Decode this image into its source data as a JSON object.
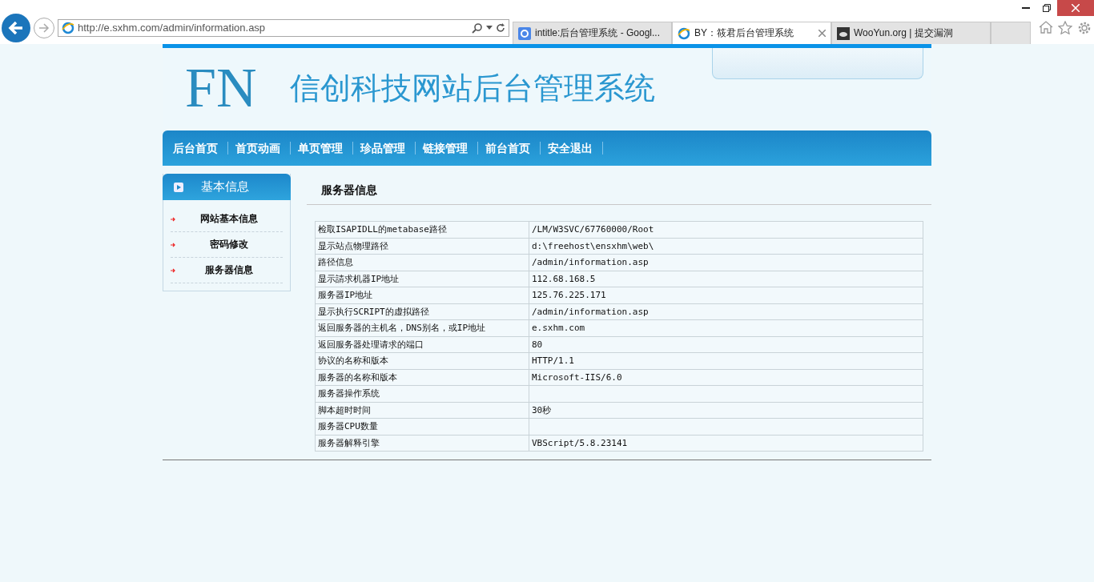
{
  "browser": {
    "address": "http://e.sxhm.com/admin/information.asp",
    "tabs": [
      {
        "title": "intitle:后台管理系统 - Googl...",
        "kind": "google",
        "selected": false
      },
      {
        "title": "BY：筱君后台管理系统",
        "kind": "ie",
        "selected": true
      },
      {
        "title": "WooYun.org | 提交漏洞",
        "kind": "cloud",
        "selected": false
      }
    ]
  },
  "header": {
    "logo": "FN",
    "title": "信创科技网站后台管理系统"
  },
  "nav": [
    "后台首页",
    "首页动画",
    "单页管理",
    "珍品管理",
    "链接管理",
    "前台首页",
    "安全退出"
  ],
  "sidebar": {
    "title": "基本信息",
    "items": [
      "网站基本信息",
      "密码修改",
      "服务器信息"
    ]
  },
  "main": {
    "title": "服务器信息",
    "rows": [
      [
        "检取ISAPIDLL的metabase路径",
        "/LM/W3SVC/67760000/Root"
      ],
      [
        "显示站点物理路径",
        "d:\\freehost\\ensxhm\\web\\"
      ],
      [
        "路径信息",
        "/admin/information.asp"
      ],
      [
        "显示請求机器IP地址",
        "112.68.168.5"
      ],
      [
        "服务器IP地址",
        "125.76.225.171"
      ],
      [
        "显示执行SCRIPT的虚拟路径",
        "/admin/information.asp"
      ],
      [
        "返回服务器的主机名，DNS别名，或IP地址",
        "e.sxhm.com"
      ],
      [
        "返回服务器处理请求的端口",
        "80"
      ],
      [
        "协议的名称和版本",
        "HTTP/1.1"
      ],
      [
        "服务器的名称和版本",
        "Microsoft-IIS/6.0"
      ],
      [
        "服务器操作系统",
        ""
      ],
      [
        "脚本超时时间",
        "30秒"
      ],
      [
        "服务器CPU数量",
        ""
      ],
      [
        "服务器解释引擎",
        "VBScript/5.8.23141"
      ]
    ]
  }
}
